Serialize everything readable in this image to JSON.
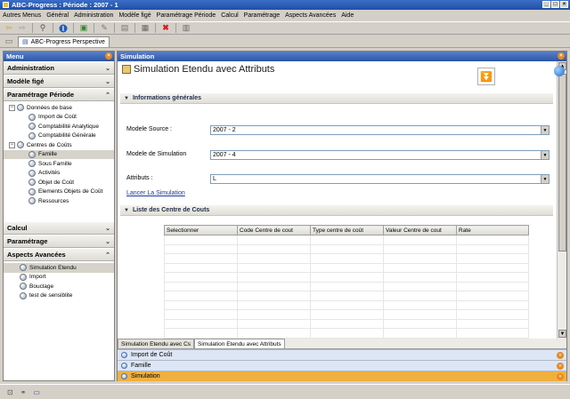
{
  "window": {
    "title": "ABC-Progress : Période : 2007 - 1",
    "minimize": "_",
    "maximize": "□",
    "close": "×"
  },
  "menubar": [
    "Autres Menus",
    "Général",
    "Administration",
    "Modèle figé",
    "Paramétrage Période",
    "Calcul",
    "Paramétrage",
    "Aspects Avancées",
    "Aide"
  ],
  "perspective": {
    "tab_label": "ABC-Progress Perspective"
  },
  "left_panel": {
    "title": "Menu",
    "sections": {
      "administration": "Administration",
      "modele_fige": "Modèle figé",
      "parametrage_periode": "Paramétrage Période",
      "calcul": "Calcul",
      "parametrage": "Paramétrage",
      "aspects_avancees": "Aspects Avancées"
    },
    "tree_periode": [
      {
        "label": "Données de base",
        "level": 0,
        "expander": "−"
      },
      {
        "label": "Import de Coût",
        "level": 1
      },
      {
        "label": "Comptabilité Analytique",
        "level": 1
      },
      {
        "label": "Comptabilité Générale",
        "level": 1
      },
      {
        "label": "Centres de Coûts",
        "level": 0,
        "expander": "−"
      },
      {
        "label": "Famille",
        "level": 1,
        "selected": true
      },
      {
        "label": "Sous Famille",
        "level": 1
      },
      {
        "label": "Activités",
        "level": 1
      },
      {
        "label": "Objet de Coût",
        "level": 1
      },
      {
        "label": "Elements Objets de Coût",
        "level": 1
      },
      {
        "label": "Ressources",
        "level": 1
      }
    ],
    "tree_avancees": [
      {
        "label": "Simulation Etendu",
        "selected": true
      },
      {
        "label": "Import"
      },
      {
        "label": "Bouclage"
      },
      {
        "label": "test de sensiblite"
      }
    ]
  },
  "main": {
    "panel_title": "Simulation",
    "form_title": "Simulation Etendu avec Attributs",
    "collapse_glyph": "⏬",
    "section_general": "Informations générales",
    "fields": {
      "modele_source": {
        "label": "Modele Source :",
        "value": "2007 - 2"
      },
      "modele_simulation": {
        "label": "Modele de Simulation",
        "value": "2007 - 4"
      },
      "attributs": {
        "label": "Attributs :",
        "value": "L"
      }
    },
    "launch_link": "Lancer La Simulation",
    "section_list": "Liste des Centre de Couts",
    "table": {
      "columns": [
        "Selectionner",
        "Code Centre de cout",
        "Type centre de coût",
        "Valeur Centre de cout",
        "Rate"
      ],
      "empty_rows": 11
    },
    "editor_tabs": [
      "Simulation Etendu avec Cs",
      "Simulation Etendu avec Attributs"
    ],
    "docked_views": [
      {
        "label": "Import de Coût",
        "color": "#dde6f5"
      },
      {
        "label": "Famille",
        "color": "#dde6f5"
      },
      {
        "label": "Simulation",
        "color": "#f0b040"
      }
    ]
  },
  "colors": {
    "accent_blue": "#2b56a8",
    "close_orange": "#e88a20",
    "active_dock": "#f0b040"
  }
}
